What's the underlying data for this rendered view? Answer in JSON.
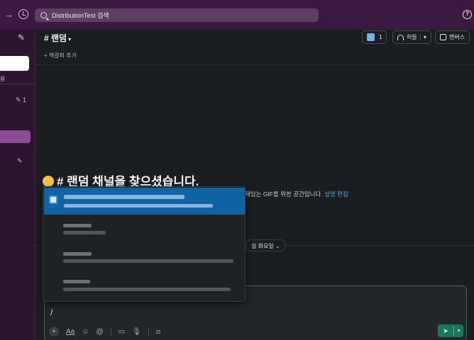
{
  "search": {
    "placeholder": "DistributionTest 검색"
  },
  "channel": {
    "name": "# 랜덤",
    "bookmark_label": "+ 책갈피 추가",
    "member_count": "1",
    "huddle_label": "허들",
    "canvas_label": "캔버스"
  },
  "welcome": {
    "title": "# 랜덤 채널을 찾으셨습니다.",
    "desc_prefix": "재있는 GIF를 위한 공간입니다.",
    "link_label": "설명 편집"
  },
  "date_divider": "실 화요일",
  "sidebar": {
    "item_count_1": "1",
    "label_partial": "용"
  },
  "composer": {
    "text": "/"
  },
  "icons": {
    "compose": "compose-icon",
    "history": "history-icon",
    "help": "help-icon",
    "send": "send-icon"
  },
  "colors": {
    "topbar": "#3b1a3f",
    "sidebar": "#2d1431",
    "selected": "#1164a3",
    "send": "#157a5a",
    "link": "#4fa7e0"
  }
}
